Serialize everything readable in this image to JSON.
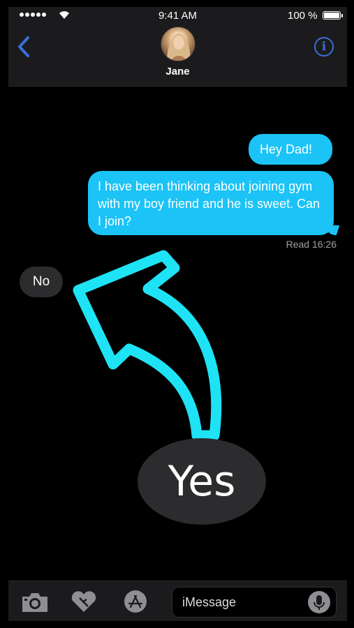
{
  "status_bar": {
    "time": "9:41 AM",
    "battery": "100 %"
  },
  "header": {
    "contact_name": "Jane",
    "info_label": "i"
  },
  "messages": [
    {
      "direction": "outgoing",
      "text": "Hey Dad!"
    },
    {
      "direction": "outgoing",
      "text": "I have been thinking about joining gym with my boy friend and he is sweet. Can I join?"
    },
    {
      "direction": "incoming",
      "text": "No"
    }
  ],
  "read_receipt": "Read 16:26",
  "overlay": {
    "yes_label": "Yes",
    "arrow_color": "#1ee3f5"
  },
  "input_bar": {
    "placeholder": "iMessage"
  },
  "colors": {
    "outgoing_bubble": "#1bc3f6",
    "incoming_bubble": "#2c2c2e",
    "link_blue": "#3b6fd6"
  },
  "icons": {
    "back": "chevron-left-icon",
    "info": "info-icon",
    "camera": "camera-icon",
    "digital_touch": "heart-icon",
    "app_store": "app-store-icon",
    "mic": "microphone-icon"
  }
}
